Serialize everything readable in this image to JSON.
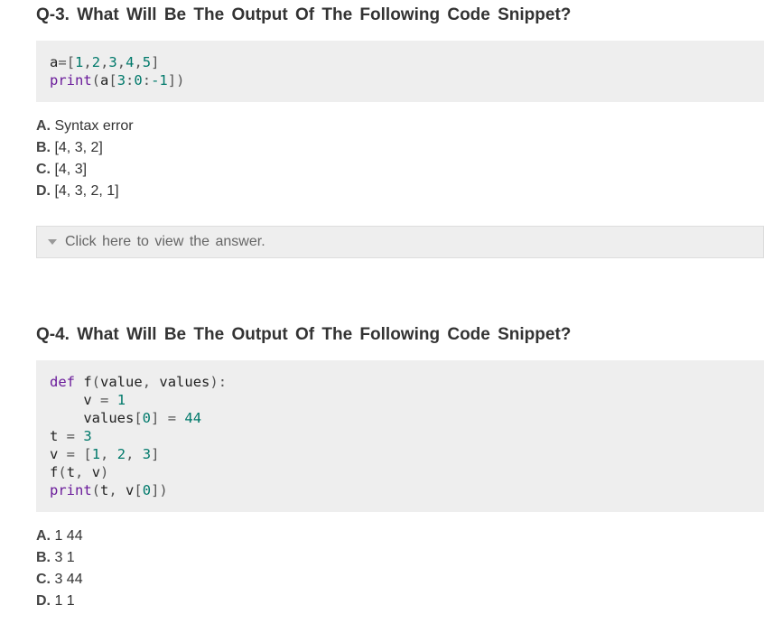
{
  "q3": {
    "title": "Q-3. What Will Be The Output Of The Following Code Snippet?",
    "code_lines": [
      [
        "a",
        "=",
        "[",
        "1",
        ",",
        "2",
        ",",
        "3",
        ",",
        "4",
        ",",
        "5",
        "]"
      ],
      [
        "print",
        "(",
        "a",
        "[",
        "3",
        ":",
        "0",
        ":",
        "-1",
        "]",
        ")"
      ]
    ],
    "options": [
      {
        "letter": "A.",
        "text": "Syntax error"
      },
      {
        "letter": "B.",
        "text": "[4, 3, 2]"
      },
      {
        "letter": "C.",
        "text": "[4, 3]"
      },
      {
        "letter": "D.",
        "text": "[4, 3, 2, 1]"
      }
    ],
    "answer_toggle": "Click here to view the answer."
  },
  "q4": {
    "title": "Q-4. What Will Be The Output Of The Following Code Snippet?",
    "code_lines": [
      "def f(value, values):",
      "    v = 1",
      "    values[0] = 44",
      "t = 3",
      "v = [1, 2, 3]",
      "f(t, v)",
      "print(t, v[0])"
    ],
    "options": [
      {
        "letter": "A.",
        "text": "1 44"
      },
      {
        "letter": "B.",
        "text": "3 1"
      },
      {
        "letter": "C.",
        "text": "3 44"
      },
      {
        "letter": "D.",
        "text": "1 1"
      }
    ]
  }
}
